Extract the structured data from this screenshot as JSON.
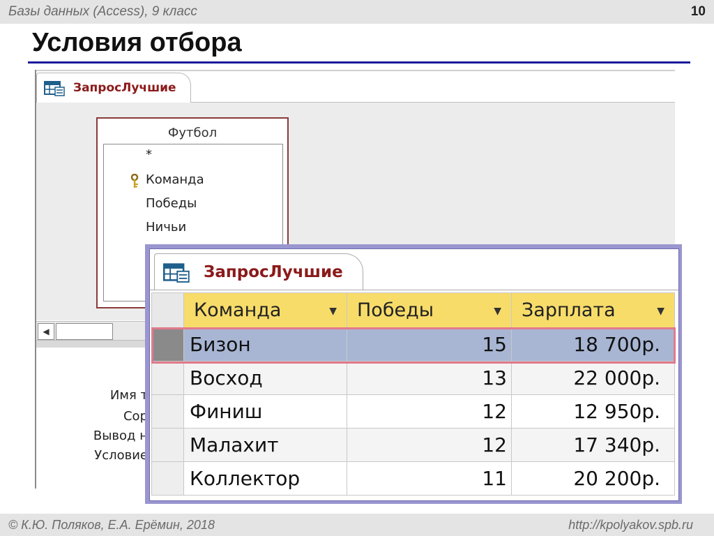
{
  "header": {
    "course": "Базы данных (Access), 9 класс",
    "page_number": "10"
  },
  "slide": {
    "title": "Условия отбора"
  },
  "design_view": {
    "tab_label": "ЗапросЛучшие",
    "table_name": "Футбол",
    "fields": [
      "*",
      "Команда",
      "Победы",
      "Ничьи"
    ],
    "key_field": "Команда",
    "grid_labels": [
      "Имя т",
      "Сор",
      "Вывод н",
      "Условие"
    ]
  },
  "result_view": {
    "tab_label": "ЗапросЛучшие",
    "columns": [
      "Команда",
      "Победы",
      "Зарплата"
    ],
    "rows": [
      {
        "team": "Бизон",
        "wins": "15",
        "salary": "18 700р."
      },
      {
        "team": "Восход",
        "wins": "13",
        "salary": "22 000р."
      },
      {
        "team": "Финиш",
        "wins": "12",
        "salary": "12 950р."
      },
      {
        "team": "Малахит",
        "wins": "12",
        "salary": "17 340р."
      },
      {
        "team": "Коллектор",
        "wins": "11",
        "salary": "20 200р."
      }
    ],
    "highlighted_row": "Бизон"
  },
  "footer": {
    "authors": "© К.Ю. Поляков, Е.А. Ерёмин, 2018",
    "url": "http://kpolyakov.spb.ru"
  },
  "colors": {
    "accent_rule": "#1a1a9c",
    "header_yellow": "#f7dc6a",
    "highlight_border": "#e07a8c",
    "tab_text": "#8b1a1a"
  },
  "icons": [
    "query-icon",
    "primary-key-icon",
    "dropdown-arrow-icon",
    "scroll-left-icon"
  ]
}
